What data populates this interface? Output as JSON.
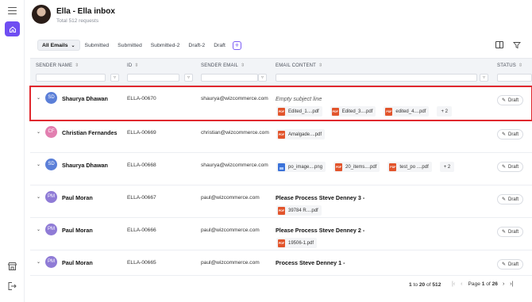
{
  "header": {
    "title": "Ella - Ella inbox",
    "subtitle": "Total 512 requests"
  },
  "tabs": [
    {
      "label": "All Emails"
    },
    {
      "label": "Submitted"
    },
    {
      "label": "Submitted"
    },
    {
      "label": "Submitted-2"
    },
    {
      "label": "Draft-2"
    },
    {
      "label": "Draft"
    }
  ],
  "columns": {
    "sender_name": "SENDER NAME",
    "id": "ID",
    "sender_email": "SENDER EMAIL",
    "email_content": "EMAIL CONTENT",
    "status": "STATUS"
  },
  "rows": [
    {
      "initials": "SD",
      "avatar_color": "#5b7fd8",
      "name": "Shaurya Dhawan",
      "id": "ELLA-00670",
      "email": "shaurya@wizcommerce.com",
      "subject": "Empty subject line",
      "attachments": [
        "Edited_1....pdf",
        "Edited_3....pdf",
        "edited_4....pdf"
      ],
      "more": "+ 2",
      "status": "Draft"
    },
    {
      "initials": "CF",
      "avatar_color": "#e27fb0",
      "name": "Christian Fernandes",
      "id": "ELLA-00669",
      "email": "christian@wizcommerce.com",
      "subject": "",
      "attachments": [
        "Amalgade....pdf"
      ],
      "more": "",
      "status": "Draft"
    },
    {
      "initials": "SD",
      "avatar_color": "#5b7fd8",
      "name": "Shaurya Dhawan",
      "id": "ELLA-00668",
      "email": "shaurya@wizcommerce.com",
      "subject": "",
      "attachments": [
        "po_image....png",
        "20_items....pdf",
        "test_po ....pdf"
      ],
      "more": "+ 2",
      "status": "Draft"
    },
    {
      "initials": "PM",
      "avatar_color": "#8f7bd6",
      "name": "Paul Moran",
      "id": "ELLA-00667",
      "email": "paul@wizcommerce.com",
      "subject": "Please Process Steve Denney 3 -",
      "attachments": [
        "39784 R....pdf"
      ],
      "more": "",
      "status": "Draft"
    },
    {
      "initials": "PM",
      "avatar_color": "#8f7bd6",
      "name": "Paul Moran",
      "id": "ELLA-00666",
      "email": "paul@wizcommerce.com",
      "subject": "Please Process Steve Denney 2 -",
      "attachments": [
        "19506-1.pdf"
      ],
      "more": "",
      "status": "Draft"
    },
    {
      "initials": "PM",
      "avatar_color": "#8f7bd6",
      "name": "Paul Moran",
      "id": "ELLA-00665",
      "email": "paul@wizcommerce.com",
      "subject": "Process Steve Denney 1 -",
      "attachments": [],
      "more": "",
      "status": "Draft"
    }
  ],
  "footer": {
    "range_from": "1",
    "range_to_word": "to",
    "range_to": "20",
    "of_word": "of",
    "total": "512",
    "page_word": "Page",
    "page": "1",
    "pages": "26"
  },
  "colors": {
    "accent": "#6f4ef2",
    "selected_outline": "#e0282e",
    "pdf": "#e2542b"
  },
  "icons": [
    "menu-icon",
    "home-icon",
    "store-icon",
    "logout-icon",
    "columns-icon",
    "filter-icon",
    "sort-icon",
    "pencil-icon",
    "pdf-file-icon",
    "image-file-icon"
  ]
}
